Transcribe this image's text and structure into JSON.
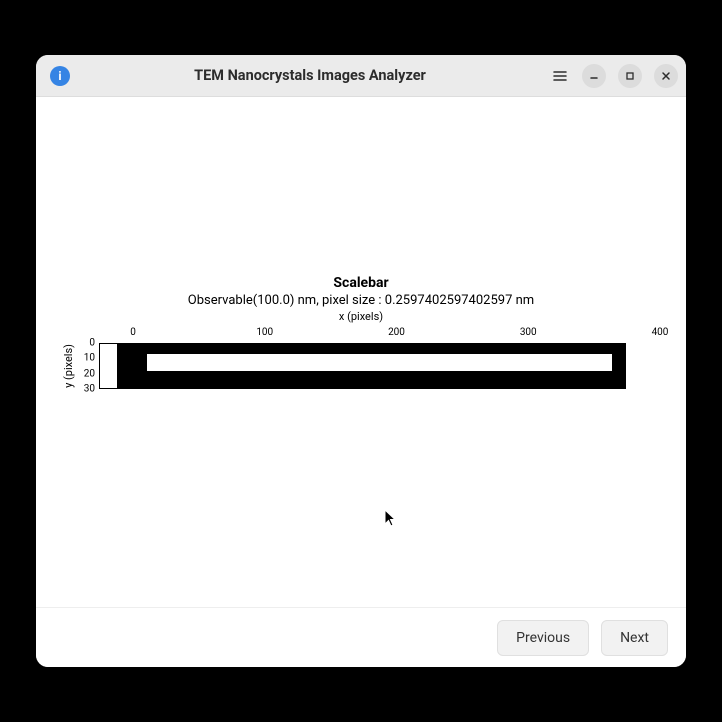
{
  "window": {
    "title": "TEM Nanocrystals Images Analyzer"
  },
  "chart_data": {
    "type": "bar",
    "title": "Scalebar",
    "subtitle": "Observable(100.0) nm, pixel size : 0.2597402597402597 nm",
    "xlabel": "x (pixels)",
    "ylabel": "y (pixels)",
    "x_ticks": [
      "0",
      "100",
      "200",
      "300",
      "400"
    ],
    "y_ticks": [
      "0",
      "10",
      "20",
      "30"
    ],
    "xlim": [
      0,
      400
    ],
    "ylim": [
      0,
      30
    ]
  },
  "footer": {
    "previous_label": "Previous",
    "next_label": "Next"
  }
}
